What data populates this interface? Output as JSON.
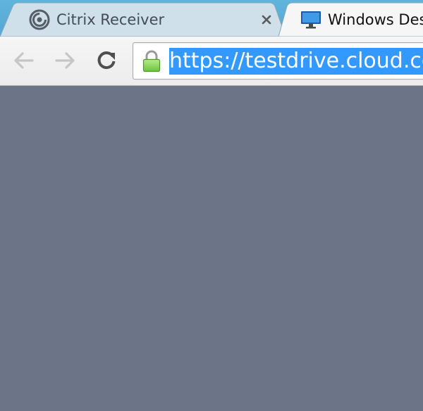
{
  "tabs": [
    {
      "title": "Citrix Receiver",
      "favicon": "citrix-receiver-icon",
      "active": false
    },
    {
      "title": "Windows Desktop",
      "favicon": "monitor-icon",
      "active": true
    }
  ],
  "tab_close_icon": "close-icon",
  "toolbar": {
    "back_icon": "back-arrow-icon",
    "forward_icon": "forward-arrow-icon",
    "reload_icon": "reload-icon"
  },
  "address_bar": {
    "security_icon": "lock-icon",
    "url": "https://testdrive.cloud.com",
    "selected": true
  },
  "colors": {
    "tabstrip": "#56a7d4",
    "content_background": "#6b7587",
    "selection": "#3399ff",
    "lock": "#7ccf48"
  }
}
